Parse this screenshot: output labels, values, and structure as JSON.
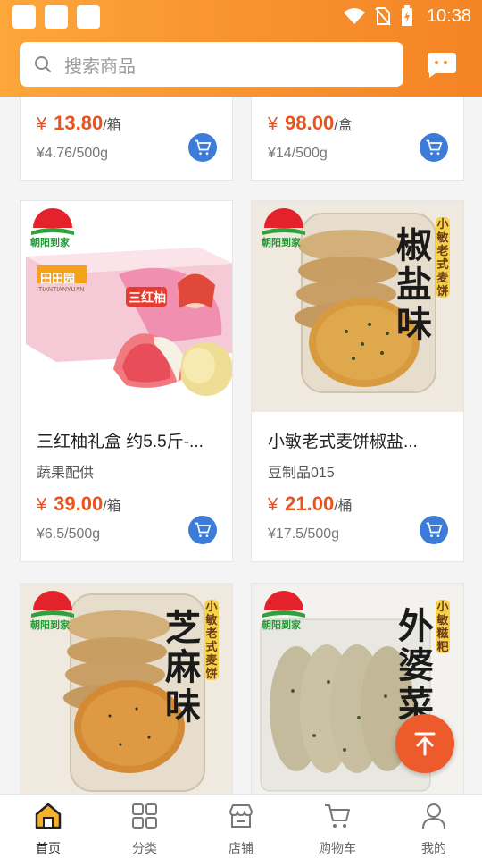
{
  "status_bar": {
    "time": "10:38"
  },
  "search": {
    "placeholder": "搜索商品"
  },
  "products_top": [
    {
      "price_currency": "¥",
      "price": "13.80",
      "unit": "/箱",
      "unit_price": "¥4.76/500g"
    },
    {
      "price_currency": "¥",
      "price": "98.00",
      "unit": "/盒",
      "unit_price": "¥14/500g"
    }
  ],
  "products": [
    {
      "name": "三红柚礼盒 约5.5斤-...",
      "category": "蔬果配供",
      "price_currency": "¥",
      "price": "39.00",
      "unit": "/箱",
      "unit_price": "¥6.5/500g",
      "image": {
        "logo_text": "朝阳到家",
        "brand": "田田园",
        "brand_pinyin": "TIANTIANYUAN",
        "badge": "三红柚"
      }
    },
    {
      "name": "小敏老式麦饼椒盐...",
      "category": "豆制品015",
      "price_currency": "¥",
      "price": "21.00",
      "unit": "/桶",
      "unit_price": "¥17.5/500g",
      "image": {
        "logo_text": "朝阳到家",
        "side_text": "小敏老式麦饼",
        "title_text": "椒盐味"
      }
    },
    {
      "image": {
        "logo_text": "朝阳到家",
        "side_text": "小敏老式麦饼",
        "title_text": "芝麻味"
      }
    },
    {
      "image": {
        "logo_text": "朝阳到家",
        "side_text": "小敏糍粑",
        "title_text": "外婆菜"
      }
    }
  ],
  "tabs": [
    {
      "label": "首页",
      "icon": "home-icon",
      "active": true
    },
    {
      "label": "分类",
      "icon": "grid-icon"
    },
    {
      "label": "店铺",
      "icon": "store-icon"
    },
    {
      "label": "购物车",
      "icon": "cart-icon"
    },
    {
      "label": "我的",
      "icon": "user-icon"
    }
  ],
  "colors": {
    "header": "#f7902e",
    "price": "#e8541e",
    "cart_button": "#3d7bd9",
    "fab": "#ed5a2c"
  }
}
